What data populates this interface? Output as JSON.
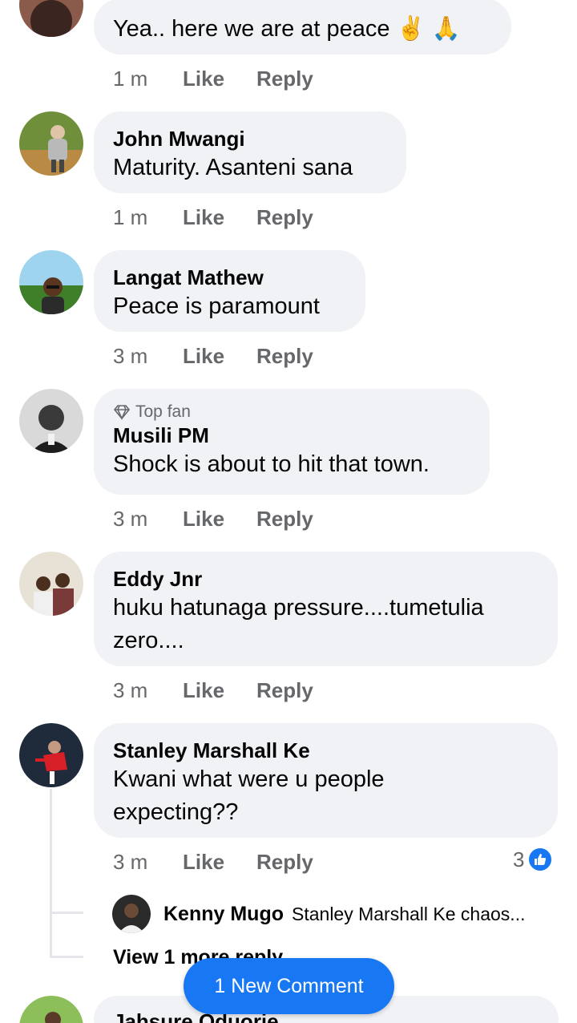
{
  "comments": [
    {
      "text": "Yea.. here we are at peace ✌️ 🙏",
      "time": "1 m",
      "like": "Like",
      "reply": "Reply"
    },
    {
      "name": "John Mwangi",
      "text": "Maturity. Asanteni sana",
      "time": "1 m",
      "like": "Like",
      "reply": "Reply"
    },
    {
      "name": "Langat Mathew",
      "text": "Peace is paramount",
      "time": "3 m",
      "like": "Like",
      "reply": "Reply"
    },
    {
      "badge": "Top fan",
      "name": "Musili PM",
      "text": "Shock is about to hit that town.",
      "time": "3 m",
      "like": "Like",
      "reply": "Reply"
    },
    {
      "name": "Eddy Jnr",
      "text": "huku hatunaga pressure....tumetulia zero....",
      "time": "3 m",
      "like": "Like",
      "reply": "Reply"
    },
    {
      "name": "Stanley Marshall Ke",
      "text": "Kwani what were u people expecting??",
      "time": "3 m",
      "like": "Like",
      "reply": "Reply",
      "reaction_count": "3"
    },
    {
      "name": "Jahsure Oduorie"
    }
  ],
  "reply_preview": {
    "name": "Kenny Mugo",
    "text": "Stanley Marshall Ke chaos..."
  },
  "view_more": "View 1 more reply",
  "new_comment_button": "1 New Comment",
  "colors": {
    "accent": "#1877f2",
    "bubble": "#f0f2f5",
    "meta": "#65676b"
  }
}
